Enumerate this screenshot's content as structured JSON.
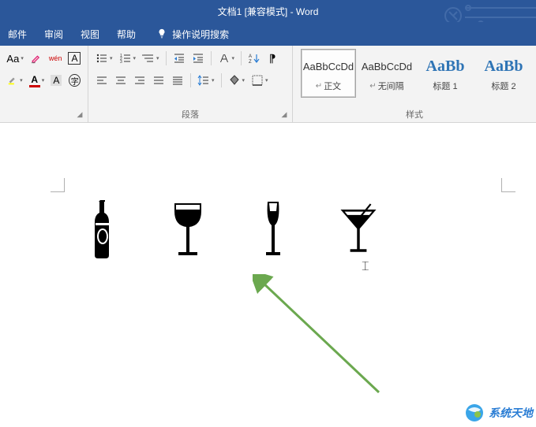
{
  "title": "文档1 [兼容模式] - Word",
  "tabs": {
    "mail": "邮件",
    "review": "审阅",
    "view": "视图",
    "help": "帮助",
    "tell_me": "操作说明搜索"
  },
  "ribbon": {
    "font": {
      "aa_label": "Aa",
      "clear_format": "A",
      "phonetic": "wén",
      "char_border": "A",
      "highlight": "A",
      "font_color": "A",
      "char_shading": "A",
      "enclose": "字"
    },
    "paragraph": {
      "group_label": "段落",
      "show_marks": "⁋"
    },
    "styles": {
      "group_label": "样式",
      "items": [
        {
          "preview": "AaBbCcDd",
          "name": "正文",
          "selected": true,
          "big": false,
          "sym": true
        },
        {
          "preview": "AaBbCcDd",
          "name": "无间隔",
          "selected": false,
          "big": false,
          "sym": true
        },
        {
          "preview": "AaBb",
          "name": "标题 1",
          "selected": false,
          "big": true,
          "sym": false,
          "accent": true
        },
        {
          "preview": "AaBb",
          "name": "标题 2",
          "selected": false,
          "big": true,
          "sym": false,
          "accent": true
        }
      ]
    }
  },
  "document": {
    "icons": [
      {
        "name": "wine-bottle-icon"
      },
      {
        "name": "wine-glass-icon"
      },
      {
        "name": "champagne-glass-icon"
      },
      {
        "name": "martini-glass-icon"
      }
    ]
  },
  "watermark": {
    "text": "系统天地"
  }
}
